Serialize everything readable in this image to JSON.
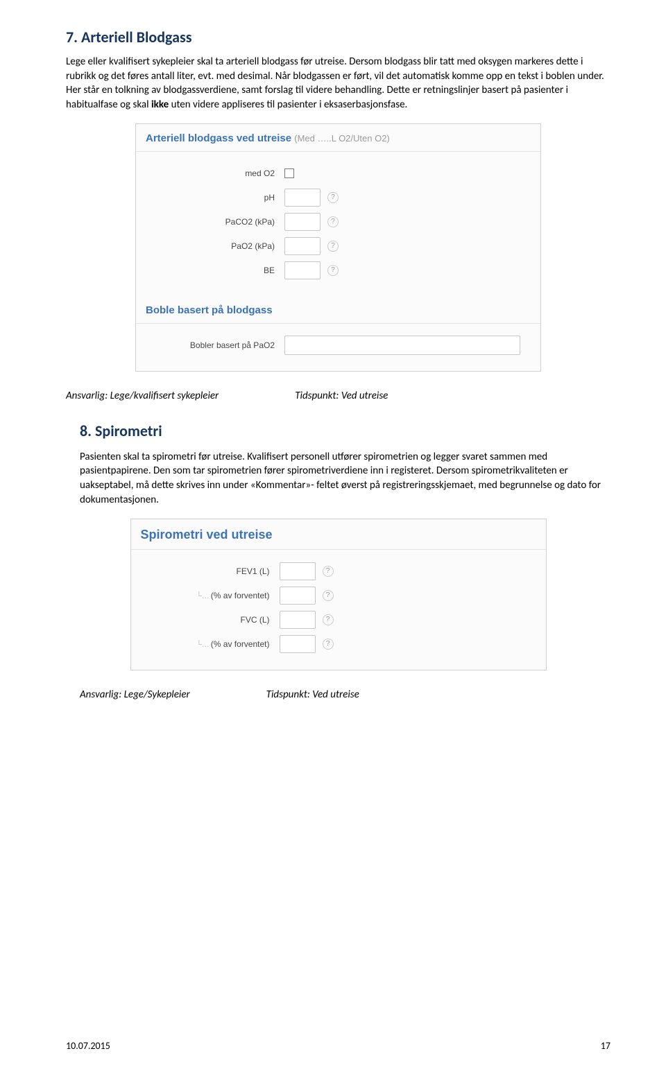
{
  "section7": {
    "title": "7. Arteriell Blodgass",
    "para_parts": {
      "p1": "Lege eller kvalifisert sykepleier skal ta arteriell blodgass før utreise. Dersom blodgass blir tatt med oksygen markeres dette i rubrikk og det føres antall liter, evt. med desimal. Når blodgassen er ført, vil det automatisk komme opp en tekst i boblen under. Her står en tolkning av blodgassverdiene, samt forslag til videre behandling. Dette er retningslinjer basert på pasienter i habitualfase og skal ",
      "p2_bold": "ikke",
      "p3": " uten videre appliseres til pasienter i eksaserbasjonsfase."
    },
    "resp_label": "Ansvarlig: Lege/kvalifisert sykepleier",
    "time_label": "Tidspunkt: Ved utreise"
  },
  "panel1": {
    "title": "Arteriell blodgass ved utreise",
    "subtitle": "(Med …..L O2/Uten O2)",
    "rows": [
      {
        "label": "med O2",
        "type": "checkbox"
      },
      {
        "label": "pH",
        "type": "input"
      },
      {
        "label": "PaCO2 (kPa)",
        "type": "input"
      },
      {
        "label": "PaO2 (kPa)",
        "type": "input"
      },
      {
        "label": "BE",
        "type": "input"
      }
    ],
    "subsection_title": "Boble basert på blodgass",
    "bobler_label": "Bobler basert på PaO2"
  },
  "section8": {
    "title": "8. Spirometri",
    "para": "Pasienten skal ta spirometri før utreise. Kvalifisert personell utfører spirometrien og legger svaret sammen med pasientpapirene. Den som tar spirometrien fører spirometriverdiene inn i registeret. Dersom spirometrikvaliteten er uakseptabel, må dette skrives inn under «Kommentar»- feltet øverst på registreringsskjemaet, med begrunnelse og dato for dokumentasjonen.",
    "resp_label": "Ansvarlig: Lege/Sykepleier",
    "time_label": "Tidspunkt: Ved utreise"
  },
  "panel2": {
    "title": "Spirometri ved utreise",
    "rows": [
      {
        "label": "FEV1 (L)",
        "tree": false
      },
      {
        "label": "(% av forventet)",
        "tree": true
      },
      {
        "label": "FVC (L)",
        "tree": false
      },
      {
        "label": "(% av forventet)",
        "tree": true
      }
    ]
  },
  "footer": {
    "date": "10.07.2015",
    "page": "17"
  },
  "glyphs": {
    "help": "?",
    "tree": "└…"
  }
}
